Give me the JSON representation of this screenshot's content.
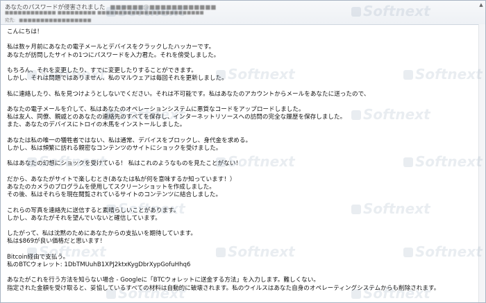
{
  "email": {
    "subject": "あなたのパスワードが侵害されました",
    "to_label": "宛先:",
    "watermark": "Softnext",
    "lines": [
      "こんにちは！",
      "",
      "私は数ヶ月前にあなたの電子メールとデバイスをクラックしたハッカーです。",
      "あなたが訪問したサイトの1つにパスワードを入力君た。それを傍受しました。",
      "",
      "もちろん、それを変更したり、すでに変更したりすることができます。",
      "しかし、それは問題ではありません、私のマルウェアは毎回それを更新しました。",
      "",
      "私に連絡したり、私を見つけようとしないでください。それは不可能です。私はあなたのアカウントからメールをあなたに送ったので、",
      "",
      "あなたの電子メールを介して、私はあなたのオペレーションシステムに悪質なコードをアップロードしました。",
      "私は友人、同僚、親戚とのあなたの連絡先のすべてを保存し、インターネットリソースへの訪問の完全な履歴を保存しました。",
      "また、あなたのデバイスにトロイの木馬をインストールしました。",
      "",
      "あなたは私の唯一の犠牲者ではない、私は通常、デバイスをブロックし、身代金を求める。",
      "しかし、私は頻繁に訪れる親密なコンテンツのサイトにショックを受けました。",
      "",
      "私はあなたの幻想にショックを受けている！ 私はこれのようなものを見たことがない！",
      "",
      "だから、あなたがサイトで楽しむとき(あなたは私が何を意味するか知っています！）",
      "あなたのカメラのプログラムを使用してスクリーンショットを作成しました。",
      "その後、私はそれらを現在閲覧されているサイトのコンテンツに結合しました。",
      "",
      "これらの写真を連絡先に送信すると素晴らしいことがあります。",
      "しかし、あなたがそれを望んでいないと確信しています。",
      "",
      "したがって、私は沈黙のためにあなたからの支払いを期待しています。",
      "私は$869が良い価格だと思います！",
      "",
      "Bitcoin経由で支払う。",
      "私のBTCウォレット:  1DbTMUuhB1XPJ2ktxKygDbrXypGofuHhq6",
      "",
      "あなたがこれを行う方法を知らない場合 - Googleに「BTCウォレットに送金する方法」を入力します。難しくない。",
      "指定された金額を受け取ると、妥協しているすべての材料は自動的に破壊されます。私のウイルスはあなた自身のオペレーティングシステムからも削除されます。"
    ]
  }
}
